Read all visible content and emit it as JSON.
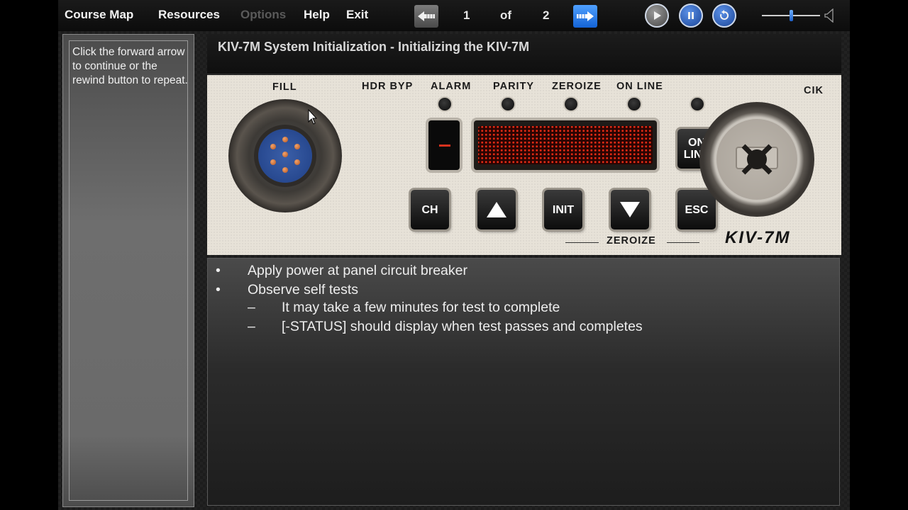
{
  "menu": {
    "course_map": "Course Map",
    "resources": "Resources",
    "options": "Options",
    "help": "Help",
    "exit": "Exit"
  },
  "pager": {
    "current": "1",
    "of_label": "of",
    "total": "2"
  },
  "volume": {
    "level": 0.5
  },
  "sidebar": {
    "instruction": "Click the forward arrow to continue or the rewind button to repeat."
  },
  "title": "KIV-7M System Initialization - Initializing the KIV-7M",
  "device": {
    "fill_label": "FILL",
    "cik_label": "CIK",
    "indicators": [
      "HDR BYP",
      "ALARM",
      "PARITY",
      "ZEROIZE",
      "ON LINE"
    ],
    "buttons": {
      "online_line1": "ON",
      "online_line2": "LINE",
      "ch": "CH",
      "init": "INIT",
      "esc": "ESC"
    },
    "zeroize_label": "ZEROIZE",
    "brand": "KIV-7M",
    "side_display": "–"
  },
  "content": {
    "bullets": [
      "Apply power at panel circuit breaker",
      "Observe self tests"
    ],
    "sub_bullets": [
      "It may take a few minutes for test to complete",
      "[-STATUS] should display when test passes and completes"
    ]
  },
  "colors": {
    "accent_blue": "#1463d6",
    "display_led": "#e02a14"
  }
}
